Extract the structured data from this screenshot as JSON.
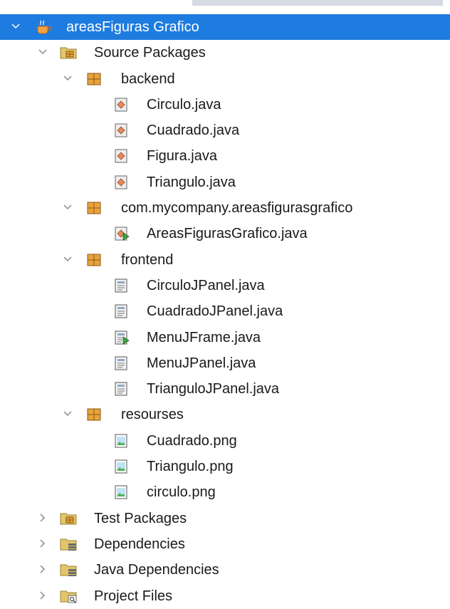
{
  "project": {
    "label": "areasFiguras Grafico",
    "icon": "java-project-icon",
    "expanded": true,
    "selected": true
  },
  "nodes": {
    "source_packages": {
      "label": "Source Packages",
      "icon": "source-packages-folder-icon"
    },
    "pkg_backend": {
      "label": "backend",
      "icon": "package-icon"
    },
    "circulo": {
      "label": "Circulo.java",
      "icon": "java-class-file-icon"
    },
    "cuadrado": {
      "label": "Cuadrado.java",
      "icon": "java-class-file-icon"
    },
    "figura": {
      "label": "Figura.java",
      "icon": "java-class-file-icon"
    },
    "triangulo": {
      "label": "Triangulo.java",
      "icon": "java-class-file-icon"
    },
    "pkg_main": {
      "label": "com.mycompany.areasfigurasgrafico",
      "icon": "package-icon"
    },
    "areas_main": {
      "label": "AreasFigurasGrafico.java",
      "icon": "java-main-class-icon"
    },
    "pkg_frontend": {
      "label": "frontend",
      "icon": "package-icon"
    },
    "circulo_panel": {
      "label": "CirculoJPanel.java",
      "icon": "java-form-file-icon"
    },
    "cuadrado_panel": {
      "label": "CuadradoJPanel.java",
      "icon": "java-form-file-icon"
    },
    "menu_frame": {
      "label": "MenuJFrame.java",
      "icon": "java-form-main-icon"
    },
    "menu_panel": {
      "label": "MenuJPanel.java",
      "icon": "java-form-file-icon"
    },
    "triangulo_panel": {
      "label": "TrianguloJPanel.java",
      "icon": "java-form-file-icon"
    },
    "pkg_resourses": {
      "label": "resourses",
      "icon": "package-icon"
    },
    "cuadrado_png": {
      "label": "Cuadrado.png",
      "icon": "image-file-icon"
    },
    "triangulo_png": {
      "label": "Triangulo.png",
      "icon": "image-file-icon"
    },
    "circulo_png": {
      "label": "circulo.png",
      "icon": "image-file-icon"
    },
    "test_packages": {
      "label": "Test Packages",
      "icon": "test-packages-folder-icon"
    },
    "dependencies": {
      "label": "Dependencies",
      "icon": "dependencies-folder-icon"
    },
    "java_dependencies": {
      "label": "Java Dependencies",
      "icon": "java-dependencies-folder-icon"
    },
    "project_files": {
      "label": "Project Files",
      "icon": "project-files-folder-icon"
    }
  },
  "colors": {
    "selection": "#1e7be0",
    "package": "#e8a33c",
    "folder": "#e3c66b"
  }
}
